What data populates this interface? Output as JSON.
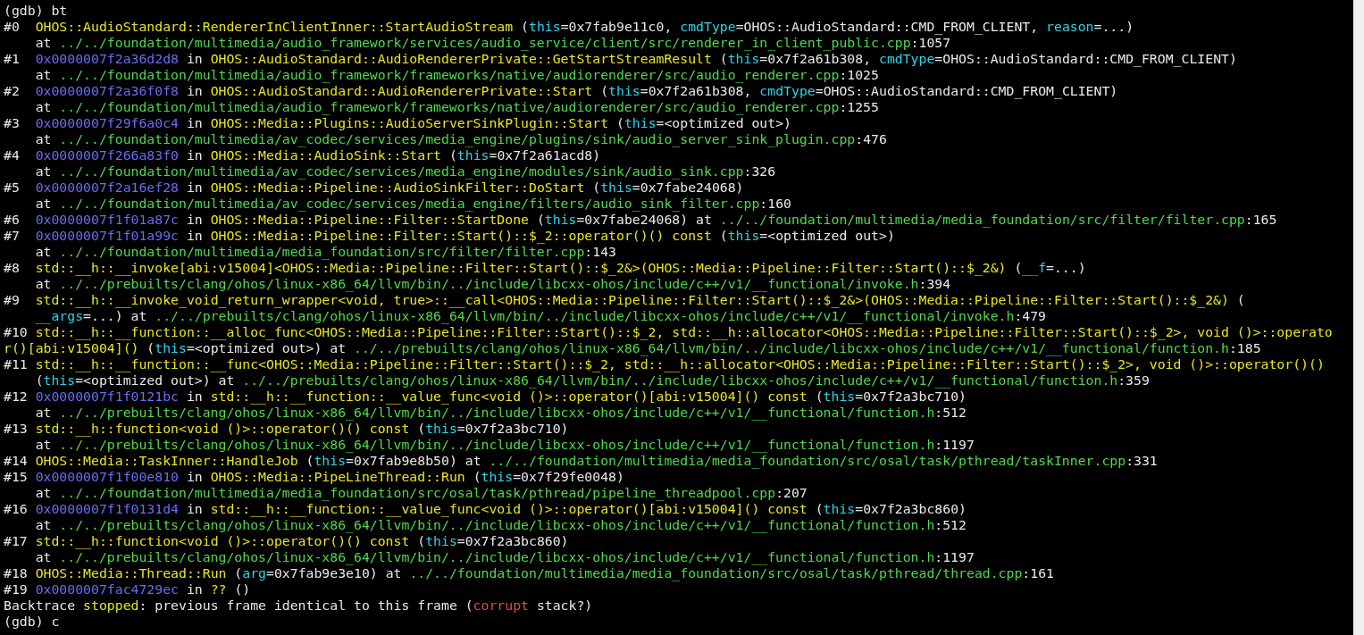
{
  "terminal": {
    "lines": [
      {
        "segments": [
          {
            "kind": "text",
            "text": "(gdb) bt"
          }
        ]
      },
      {
        "segments": [
          {
            "kind": "text",
            "text": "#0  "
          },
          {
            "kind": "function",
            "text": "OHOS::AudioStandard::RendererInClientInner::StartAudioStream"
          },
          {
            "kind": "text",
            "text": " ("
          },
          {
            "kind": "argument",
            "text": "this"
          },
          {
            "kind": "text",
            "text": "=0x7fab9e11c0, "
          },
          {
            "kind": "argument",
            "text": "cmdType"
          },
          {
            "kind": "text",
            "text": "=OHOS::AudioStandard::CMD_FROM_CLIENT, "
          },
          {
            "kind": "argument",
            "text": "reason"
          },
          {
            "kind": "text",
            "text": "=...)"
          }
        ]
      },
      {
        "segments": [
          {
            "kind": "text",
            "text": "    at "
          },
          {
            "kind": "path",
            "text": "../../foundation/multimedia/audio_framework/services/audio_service/client/src/renderer_in_client_public.cpp"
          },
          {
            "kind": "text",
            "text": ":1057"
          }
        ]
      },
      {
        "segments": [
          {
            "kind": "text",
            "text": "#1  "
          },
          {
            "kind": "address",
            "text": "0x0000007f2a36d2d8"
          },
          {
            "kind": "text",
            "text": " in "
          },
          {
            "kind": "function",
            "text": "OHOS::AudioStandard::AudioRendererPrivate::GetStartStreamResult"
          },
          {
            "kind": "text",
            "text": " ("
          },
          {
            "kind": "argument",
            "text": "this"
          },
          {
            "kind": "text",
            "text": "=0x7f2a61b308, "
          },
          {
            "kind": "argument",
            "text": "cmdType"
          },
          {
            "kind": "text",
            "text": "=OHOS::AudioStandard::CMD_FROM_CLIENT)"
          }
        ]
      },
      {
        "segments": [
          {
            "kind": "text",
            "text": "    at "
          },
          {
            "kind": "path",
            "text": "../../foundation/multimedia/audio_framework/frameworks/native/audiorenderer/src/audio_renderer.cpp"
          },
          {
            "kind": "text",
            "text": ":1025"
          }
        ]
      },
      {
        "segments": [
          {
            "kind": "text",
            "text": "#2  "
          },
          {
            "kind": "address",
            "text": "0x0000007f2a36f0f8"
          },
          {
            "kind": "text",
            "text": " in "
          },
          {
            "kind": "function",
            "text": "OHOS::AudioStandard::AudioRendererPrivate::Start"
          },
          {
            "kind": "text",
            "text": " ("
          },
          {
            "kind": "argument",
            "text": "this"
          },
          {
            "kind": "text",
            "text": "=0x7f2a61b308, "
          },
          {
            "kind": "argument",
            "text": "cmdType"
          },
          {
            "kind": "text",
            "text": "=OHOS::AudioStandard::CMD_FROM_CLIENT)"
          }
        ]
      },
      {
        "segments": [
          {
            "kind": "text",
            "text": "    at "
          },
          {
            "kind": "path",
            "text": "../../foundation/multimedia/audio_framework/frameworks/native/audiorenderer/src/audio_renderer.cpp"
          },
          {
            "kind": "text",
            "text": ":1255"
          }
        ]
      },
      {
        "segments": [
          {
            "kind": "text",
            "text": "#3  "
          },
          {
            "kind": "address",
            "text": "0x0000007f29f6a0c4"
          },
          {
            "kind": "text",
            "text": " in "
          },
          {
            "kind": "function",
            "text": "OHOS::Media::Plugins::AudioServerSinkPlugin::Start"
          },
          {
            "kind": "text",
            "text": " ("
          },
          {
            "kind": "argument",
            "text": "this"
          },
          {
            "kind": "text",
            "text": "=<optimized out>)"
          }
        ]
      },
      {
        "segments": [
          {
            "kind": "text",
            "text": "    at "
          },
          {
            "kind": "path",
            "text": "../../foundation/multimedia/av_codec/services/media_engine/plugins/sink/audio_server_sink_plugin.cpp"
          },
          {
            "kind": "text",
            "text": ":476"
          }
        ]
      },
      {
        "segments": [
          {
            "kind": "text",
            "text": "#4  "
          },
          {
            "kind": "address",
            "text": "0x0000007f266a83f0"
          },
          {
            "kind": "text",
            "text": " in "
          },
          {
            "kind": "function",
            "text": "OHOS::Media::AudioSink::Start"
          },
          {
            "kind": "text",
            "text": " ("
          },
          {
            "kind": "argument",
            "text": "this"
          },
          {
            "kind": "text",
            "text": "=0x7f2a61acd8)"
          }
        ]
      },
      {
        "segments": [
          {
            "kind": "text",
            "text": "    at "
          },
          {
            "kind": "path",
            "text": "../../foundation/multimedia/av_codec/services/media_engine/modules/sink/audio_sink.cpp"
          },
          {
            "kind": "text",
            "text": ":326"
          }
        ]
      },
      {
        "segments": [
          {
            "kind": "text",
            "text": "#5  "
          },
          {
            "kind": "address",
            "text": "0x0000007f2a16ef28"
          },
          {
            "kind": "text",
            "text": " in "
          },
          {
            "kind": "function",
            "text": "OHOS::Media::Pipeline::AudioSinkFilter::DoStart"
          },
          {
            "kind": "text",
            "text": " ("
          },
          {
            "kind": "argument",
            "text": "this"
          },
          {
            "kind": "text",
            "text": "=0x7fabe24068)"
          }
        ]
      },
      {
        "segments": [
          {
            "kind": "text",
            "text": "    at "
          },
          {
            "kind": "path",
            "text": "../../foundation/multimedia/av_codec/services/media_engine/filters/audio_sink_filter.cpp"
          },
          {
            "kind": "text",
            "text": ":160"
          }
        ]
      },
      {
        "segments": [
          {
            "kind": "text",
            "text": "#6  "
          },
          {
            "kind": "address",
            "text": "0x0000007f1f01a87c"
          },
          {
            "kind": "text",
            "text": " in "
          },
          {
            "kind": "function",
            "text": "OHOS::Media::Pipeline::Filter::StartDone"
          },
          {
            "kind": "text",
            "text": " ("
          },
          {
            "kind": "argument",
            "text": "this"
          },
          {
            "kind": "text",
            "text": "=0x7fabe24068) at "
          },
          {
            "kind": "path",
            "text": "../../foundation/multimedia/media_foundation/src/filter/filter.cpp"
          },
          {
            "kind": "text",
            "text": ":165"
          }
        ]
      },
      {
        "segments": [
          {
            "kind": "text",
            "text": "#7  "
          },
          {
            "kind": "address",
            "text": "0x0000007f1f01a99c"
          },
          {
            "kind": "text",
            "text": " in "
          },
          {
            "kind": "function",
            "text": "OHOS::Media::Pipeline::Filter::Start()::$_2::operator()() const"
          },
          {
            "kind": "text",
            "text": " ("
          },
          {
            "kind": "argument",
            "text": "this"
          },
          {
            "kind": "text",
            "text": "=<optimized out>)"
          }
        ]
      },
      {
        "segments": [
          {
            "kind": "text",
            "text": "    at "
          },
          {
            "kind": "path",
            "text": "../../foundation/multimedia/media_foundation/src/filter/filter.cpp"
          },
          {
            "kind": "text",
            "text": ":143"
          }
        ]
      },
      {
        "segments": [
          {
            "kind": "text",
            "text": "#8  "
          },
          {
            "kind": "function",
            "text": "std::__h::__invoke[abi:v15004]<OHOS::Media::Pipeline::Filter::Start()::$_2&>(OHOS::Media::Pipeline::Filter::Start()::$_2&)"
          },
          {
            "kind": "text",
            "text": " ("
          },
          {
            "kind": "argument",
            "text": "__f"
          },
          {
            "kind": "text",
            "text": "=...)"
          }
        ]
      },
      {
        "segments": [
          {
            "kind": "text",
            "text": "    at "
          },
          {
            "kind": "path",
            "text": "../../prebuilts/clang/ohos/linux-x86_64/llvm/bin/../include/libcxx-ohos/include/c++/v1/__functional/invoke.h"
          },
          {
            "kind": "text",
            "text": ":394"
          }
        ]
      },
      {
        "segments": [
          {
            "kind": "text",
            "text": "#9  "
          },
          {
            "kind": "function",
            "text": "std::__h::__invoke_void_return_wrapper<void, true>::__call<OHOS::Media::Pipeline::Filter::Start()::$_2&>(OHOS::Media::Pipeline::Filter::Start()::$_2&)"
          },
          {
            "kind": "text",
            "text": " ("
          }
        ]
      },
      {
        "indent": true,
        "segments": [
          {
            "kind": "argument",
            "text": "__args"
          },
          {
            "kind": "text",
            "text": "=...) at "
          },
          {
            "kind": "path",
            "text": "../../prebuilts/clang/ohos/linux-x86_64/llvm/bin/../include/libcxx-ohos/include/c++/v1/__functional/invoke.h"
          },
          {
            "kind": "text",
            "text": ":479"
          }
        ]
      },
      {
        "segments": [
          {
            "kind": "text",
            "text": "#10 "
          },
          {
            "kind": "function",
            "text": "std::__h::__function::__alloc_func<OHOS::Media::Pipeline::Filter::Start()::$_2, std::__h::allocator<OHOS::Media::Pipeline::Filter::Start()::$_2>, void ()>::operato"
          }
        ]
      },
      {
        "segments": [
          {
            "kind": "function",
            "text": "r()[abi:v15004]()"
          },
          {
            "kind": "text",
            "text": " ("
          },
          {
            "kind": "argument",
            "text": "this"
          },
          {
            "kind": "text",
            "text": "=<optimized out>) at "
          },
          {
            "kind": "path",
            "text": "../../prebuilts/clang/ohos/linux-x86_64/llvm/bin/../include/libcxx-ohos/include/c++/v1/__functional/function.h"
          },
          {
            "kind": "text",
            "text": ":185"
          }
        ]
      },
      {
        "segments": [
          {
            "kind": "text",
            "text": "#11 "
          },
          {
            "kind": "function",
            "text": "std::__h::__function::__func<OHOS::Media::Pipeline::Filter::Start()::$_2, std::__h::allocator<OHOS::Media::Pipeline::Filter::Start()::$_2>, void ()>::operator()()"
          }
        ]
      },
      {
        "segments": [
          {
            "kind": "text",
            "text": "    ("
          },
          {
            "kind": "argument",
            "text": "this"
          },
          {
            "kind": "text",
            "text": "=<optimized out>) at "
          },
          {
            "kind": "path",
            "text": "../../prebuilts/clang/ohos/linux-x86_64/llvm/bin/../include/libcxx-ohos/include/c++/v1/__functional/function.h"
          },
          {
            "kind": "text",
            "text": ":359"
          }
        ]
      },
      {
        "segments": [
          {
            "kind": "text",
            "text": "#12 "
          },
          {
            "kind": "address",
            "text": "0x0000007f1f0121bc"
          },
          {
            "kind": "text",
            "text": " in "
          },
          {
            "kind": "function",
            "text": "std::__h::__function::__value_func<void ()>::operator()[abi:v15004]() const"
          },
          {
            "kind": "text",
            "text": " ("
          },
          {
            "kind": "argument",
            "text": "this"
          },
          {
            "kind": "text",
            "text": "=0x7f2a3bc710)"
          }
        ]
      },
      {
        "segments": [
          {
            "kind": "text",
            "text": "    at "
          },
          {
            "kind": "path",
            "text": "../../prebuilts/clang/ohos/linux-x86_64/llvm/bin/../include/libcxx-ohos/include/c++/v1/__functional/function.h"
          },
          {
            "kind": "text",
            "text": ":512"
          }
        ]
      },
      {
        "segments": [
          {
            "kind": "text",
            "text": "#13 "
          },
          {
            "kind": "function",
            "text": "std::__h::function<void ()>::operator()() const"
          },
          {
            "kind": "text",
            "text": " ("
          },
          {
            "kind": "argument",
            "text": "this"
          },
          {
            "kind": "text",
            "text": "=0x7f2a3bc710)"
          }
        ]
      },
      {
        "segments": [
          {
            "kind": "text",
            "text": "    at "
          },
          {
            "kind": "path",
            "text": "../../prebuilts/clang/ohos/linux-x86_64/llvm/bin/../include/libcxx-ohos/include/c++/v1/__functional/function.h"
          },
          {
            "kind": "text",
            "text": ":1197"
          }
        ]
      },
      {
        "segments": [
          {
            "kind": "text",
            "text": "#14 "
          },
          {
            "kind": "function",
            "text": "OHOS::Media::TaskInner::HandleJob"
          },
          {
            "kind": "text",
            "text": " ("
          },
          {
            "kind": "argument",
            "text": "this"
          },
          {
            "kind": "text",
            "text": "=0x7fab9e8b50) at "
          },
          {
            "kind": "path",
            "text": "../../foundation/multimedia/media_foundation/src/osal/task/pthread/taskInner.cpp"
          },
          {
            "kind": "text",
            "text": ":331"
          }
        ]
      },
      {
        "segments": [
          {
            "kind": "text",
            "text": "#15 "
          },
          {
            "kind": "address",
            "text": "0x0000007f1f00e810"
          },
          {
            "kind": "text",
            "text": " in "
          },
          {
            "kind": "function",
            "text": "OHOS::Media::PipeLineThread::Run"
          },
          {
            "kind": "text",
            "text": " ("
          },
          {
            "kind": "argument",
            "text": "this"
          },
          {
            "kind": "text",
            "text": "=0x7f29fe0048)"
          }
        ]
      },
      {
        "segments": [
          {
            "kind": "text",
            "text": "    at "
          },
          {
            "kind": "path",
            "text": "../../foundation/multimedia/media_foundation/src/osal/task/pthread/pipeline_threadpool.cpp"
          },
          {
            "kind": "text",
            "text": ":207"
          }
        ]
      },
      {
        "segments": [
          {
            "kind": "text",
            "text": "#16 "
          },
          {
            "kind": "address",
            "text": "0x0000007f1f0131d4"
          },
          {
            "kind": "text",
            "text": " in "
          },
          {
            "kind": "function",
            "text": "std::__h::__function::__value_func<void ()>::operator()[abi:v15004]() const"
          },
          {
            "kind": "text",
            "text": " ("
          },
          {
            "kind": "argument",
            "text": "this"
          },
          {
            "kind": "text",
            "text": "=0x7f2a3bc860)"
          }
        ]
      },
      {
        "segments": [
          {
            "kind": "text",
            "text": "    at "
          },
          {
            "kind": "path",
            "text": "../../prebuilts/clang/ohos/linux-x86_64/llvm/bin/../include/libcxx-ohos/include/c++/v1/__functional/function.h"
          },
          {
            "kind": "text",
            "text": ":512"
          }
        ]
      },
      {
        "segments": [
          {
            "kind": "text",
            "text": "#17 "
          },
          {
            "kind": "function",
            "text": "std::__h::function<void ()>::operator()() const"
          },
          {
            "kind": "text",
            "text": " ("
          },
          {
            "kind": "argument",
            "text": "this"
          },
          {
            "kind": "text",
            "text": "=0x7f2a3bc860)"
          }
        ]
      },
      {
        "segments": [
          {
            "kind": "text",
            "text": "    at "
          },
          {
            "kind": "path",
            "text": "../../prebuilts/clang/ohos/linux-x86_64/llvm/bin/../include/libcxx-ohos/include/c++/v1/__functional/function.h"
          },
          {
            "kind": "text",
            "text": ":1197"
          }
        ]
      },
      {
        "segments": [
          {
            "kind": "text",
            "text": "#18 "
          },
          {
            "kind": "function",
            "text": "OHOS::Media::Thread::Run"
          },
          {
            "kind": "text",
            "text": " ("
          },
          {
            "kind": "argument",
            "text": "arg"
          },
          {
            "kind": "text",
            "text": "=0x7fab9e3e10) at "
          },
          {
            "kind": "path",
            "text": "../../foundation/multimedia/media_foundation/src/osal/task/pthread/thread.cpp"
          },
          {
            "kind": "text",
            "text": ":161"
          }
        ]
      },
      {
        "segments": [
          {
            "kind": "text",
            "text": "#19 "
          },
          {
            "kind": "address",
            "text": "0x0000007fac4729ec"
          },
          {
            "kind": "text",
            "text": " in "
          },
          {
            "kind": "function",
            "text": "??"
          },
          {
            "kind": "text",
            "text": " ()"
          }
        ]
      },
      {
        "segments": [
          {
            "kind": "text",
            "text": "Backtrace "
          },
          {
            "kind": "function",
            "text": "stopped"
          },
          {
            "kind": "text",
            "text": ": previous frame identical to this frame ("
          },
          {
            "kind": "error",
            "text": "corrupt"
          },
          {
            "kind": "text",
            "text": " stack?)"
          }
        ]
      },
      {
        "segments": [
          {
            "kind": "text",
            "text": "(gdb) c"
          }
        ]
      }
    ]
  }
}
